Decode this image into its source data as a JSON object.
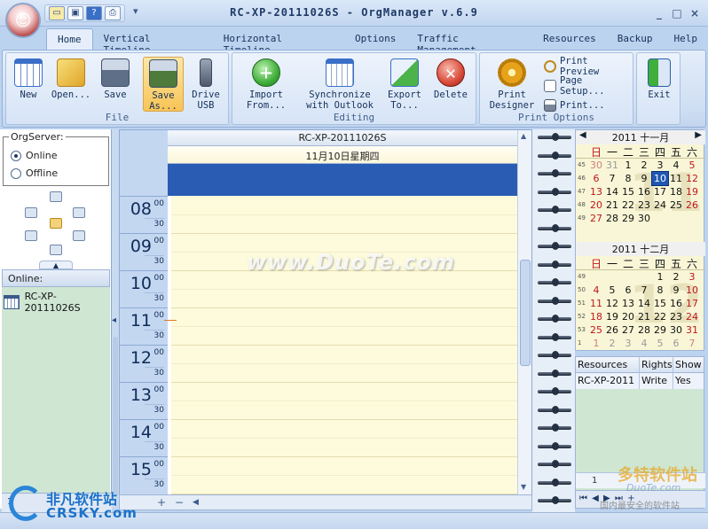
{
  "title_bar": {
    "app_title": "RC-XP-20111026S - OrgManager v.6.9",
    "qat_icons": [
      "folder-icon",
      "save-icon",
      "help-icon",
      "print-icon"
    ],
    "qat_more": "▾",
    "window_buttons": [
      "_",
      "□",
      "×"
    ]
  },
  "tabs": [
    "Home",
    "Vertical Timeline",
    "Horizontal Timeline",
    "Options",
    "Traffic Management",
    "Resources",
    "Backup",
    "Help"
  ],
  "ribbon": {
    "file": {
      "label": "File",
      "buttons": [
        {
          "label": "New",
          "icon": "calendar-grid-icon"
        },
        {
          "label": "Open...",
          "icon": "folder-open-icon"
        },
        {
          "label": "Save",
          "icon": "floppy-icon"
        },
        {
          "label": "Save As...",
          "icon": "save-as-icon"
        },
        {
          "label": "Drive USB",
          "icon": "usb-drive-icon"
        }
      ],
      "save_as_line1": "Save",
      "save_as_line2": "As...",
      "drive_line1": "Drive",
      "drive_line2": "USB"
    },
    "editing": {
      "label": "Editing",
      "import_line1": "Import",
      "import_line2": "From...",
      "sync_line1": "Synchronize",
      "sync_line2": "with Outlook",
      "export_line1": "Export",
      "export_line2": "To...",
      "delete_label": "Delete"
    },
    "print": {
      "label": "Print Options",
      "designer_line1": "Print",
      "designer_line2": "Designer",
      "preview": "Print Preview",
      "setup": "Page Setup...",
      "print": "Print..."
    },
    "exit_label": "Exit",
    "colors": {
      "green": "#3fae3a",
      "red": "#d94b3a",
      "blue": "#3a6fc8",
      "gold": "#e6a21a"
    }
  },
  "left_panel": {
    "orgserver_title": "OrgServer:",
    "online_label": "Online",
    "offline_label": "Offline",
    "selected": "Online",
    "online_header": "Online:",
    "server_name": "RC-XP-20111026S"
  },
  "day_view": {
    "resource_name": "RC-XP-20111026S",
    "date_label": "11月10日星期四",
    "hours": [
      "08",
      "09",
      "10",
      "11",
      "12",
      "13",
      "14",
      "15"
    ],
    "min_00": "00",
    "min_30": "30"
  },
  "calendar_nov": {
    "title": "2011 十一月",
    "dow": [
      "日",
      "一",
      "二",
      "三",
      "四",
      "五",
      "六"
    ],
    "weeks": [
      {
        "wk": "45",
        "days": [
          "30",
          "31",
          "1",
          "2",
          "3",
          "4",
          "5"
        ]
      },
      {
        "wk": "46",
        "days": [
          "6",
          "7",
          "8",
          "9",
          "10",
          "11",
          "12"
        ]
      },
      {
        "wk": "47",
        "days": [
          "13",
          "14",
          "15",
          "16",
          "17",
          "18",
          "19"
        ]
      },
      {
        "wk": "48",
        "days": [
          "20",
          "21",
          "22",
          "23",
          "24",
          "25",
          "26"
        ]
      },
      {
        "wk": "49",
        "days": [
          "27",
          "28",
          "29",
          "30",
          "",
          "",
          ""
        ]
      }
    ],
    "selected_day": "10",
    "watermark": "11"
  },
  "calendar_dec": {
    "title": "2011 十二月",
    "dow": [
      "日",
      "一",
      "二",
      "三",
      "四",
      "五",
      "六"
    ],
    "weeks": [
      {
        "wk": "49",
        "days": [
          "",
          "",
          "",
          "",
          "1",
          "2",
          "3"
        ]
      },
      {
        "wk": "50",
        "days": [
          "4",
          "5",
          "6",
          "7",
          "8",
          "9",
          "10"
        ]
      },
      {
        "wk": "51",
        "days": [
          "11",
          "12",
          "13",
          "14",
          "15",
          "16",
          "17"
        ]
      },
      {
        "wk": "52",
        "days": [
          "18",
          "19",
          "20",
          "21",
          "22",
          "23",
          "24"
        ]
      },
      {
        "wk": "53",
        "days": [
          "25",
          "26",
          "27",
          "28",
          "29",
          "30",
          "31"
        ]
      },
      {
        "wk": "1",
        "days": [
          "1",
          "2",
          "3",
          "4",
          "5",
          "6",
          "7"
        ]
      }
    ],
    "watermark": "12"
  },
  "resources_table": {
    "headers": [
      "Resources",
      "Rights",
      "Show"
    ],
    "rows": [
      [
        "RC-XP-2011",
        "Write",
        "Yes"
      ]
    ],
    "page": "1",
    "nav": "⏮ ◀ ▶ ⏭ +"
  },
  "scroll_bottom": {
    "plus": "+",
    "minus": "−",
    "left_arrow": "◀"
  },
  "left_status": "1",
  "watermarks": {
    "center": "www.DuoTe.com",
    "left_cn": "非凡软件站",
    "left_en": "CRSKY.com",
    "right_cn": "多特软件站",
    "right_en": "DuoTe.com",
    "right_sub": "国内最安全的软件站"
  }
}
